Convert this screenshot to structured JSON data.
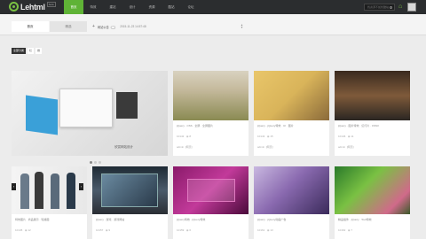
{
  "brand": {
    "logo_text": "Lehtml",
    "badge": "beta"
  },
  "nav": {
    "items": [
      "首页",
      "特效",
      "建站",
      "设计",
      "资源",
      "酷站",
      "论坛"
    ],
    "active_index": 0
  },
  "search": {
    "placeholder": "找资源不如找酷站"
  },
  "tabs": [
    {
      "label": "首页"
    },
    {
      "label": "精选"
    }
  ],
  "announcement": {
    "text": "网站公告（二）",
    "date": "2015-11-23 14:57:48"
  },
  "filter": {
    "chips": [
      "全部分类",
      "栏",
      "推"
    ]
  },
  "hero": {
    "caption": "欣赏网站设计",
    "colors": [
      "#dcdcdc",
      "#3aa0d8",
      "#ffffff"
    ]
  },
  "cards_top": [
    {
      "tags": [
        "jQuery",
        "CSS",
        "全屏",
        "全屏图片"
      ],
      "views": "10142",
      "likes": "8",
      "author": "admin",
      "date": "[网页]",
      "colors": [
        "#c3b89a",
        "#f0ece2"
      ]
    },
    {
      "tags": [
        "jQuery",
        "jQuery特效",
        "UI",
        "图片"
      ],
      "views": "10143",
      "likes": "15",
      "author": "admin",
      "date": "[网页]",
      "colors": [
        "#d9b45a",
        "#6a4a2a"
      ]
    },
    {
      "tags": [
        "jQuery",
        "图片特效",
        "幻灯片",
        "CSS3"
      ],
      "views": "10146",
      "likes": "11",
      "author": "admin",
      "date": "[网页]",
      "colors": [
        "#2a2622",
        "#7e5a3a"
      ]
    }
  ],
  "cards_bottom": [
    {
      "tags": [
        "特效图片",
        "商品展示",
        "轮播图"
      ],
      "views": "10145",
      "likes": "12"
    },
    {
      "tags": [
        "jQuery",
        "游戏",
        "游戏网站"
      ],
      "views": "10157",
      "likes": "9"
    },
    {
      "tags": [
        "jQuery特效",
        "jQuery特效"
      ],
      "views": "10159",
      "likes": "6"
    },
    {
      "tags": [
        "jQuery",
        "jQuery动画广告"
      ],
      "views": "10161",
      "likes": "13"
    },
    {
      "tags": [
        "精品插件",
        "jQuery",
        "Tool特效"
      ],
      "views": "10162",
      "likes": "7"
    }
  ]
}
